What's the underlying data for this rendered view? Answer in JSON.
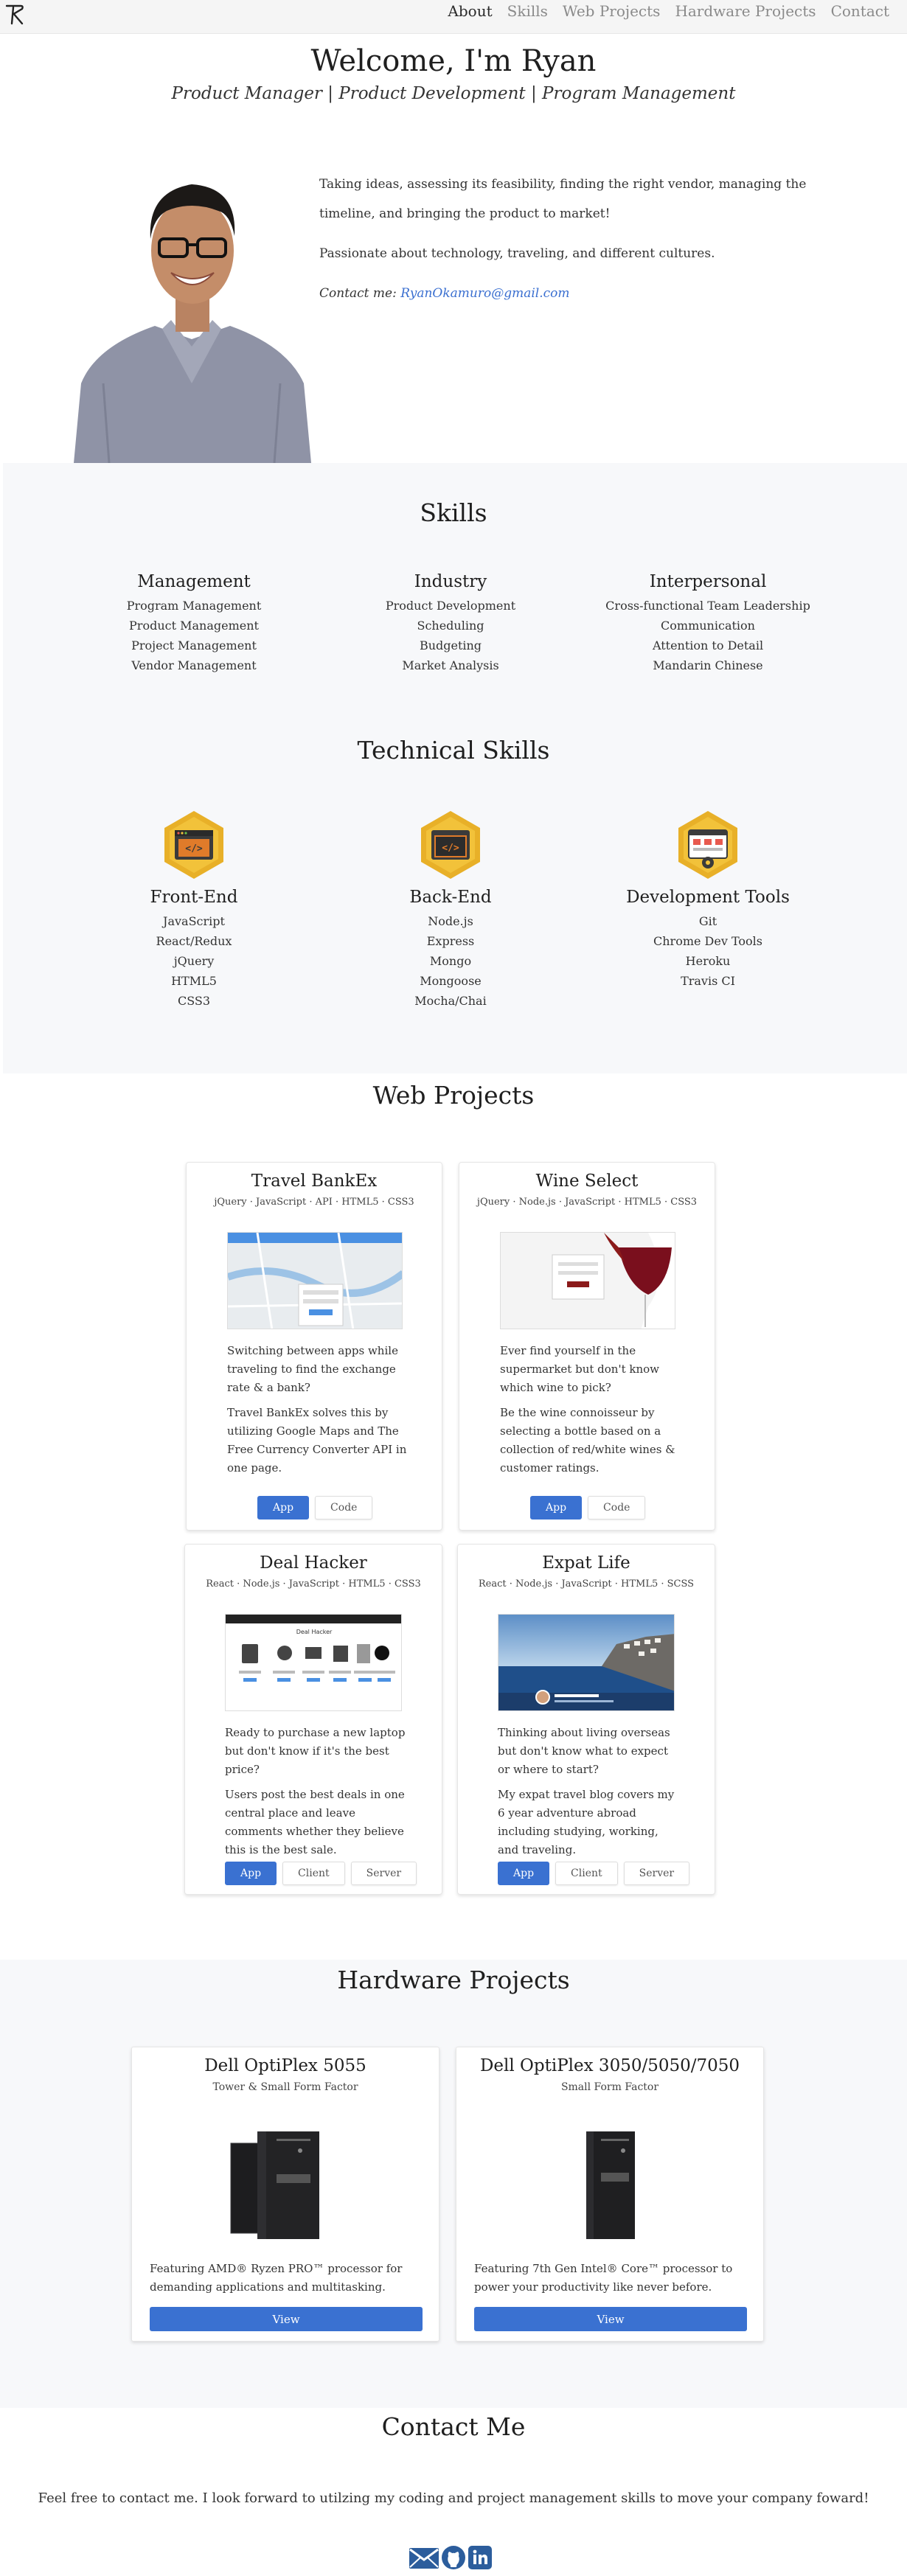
{
  "nav": {
    "links": [
      "About",
      "Skills",
      "Web Projects",
      "Hardware Projects",
      "Contact"
    ],
    "active": "About"
  },
  "hero": {
    "title": "Welcome, I'm Ryan",
    "subtitle": "Product Manager | Product Development | Program Management",
    "about": [
      "Taking ideas, assessing its feasibility, finding the right vendor, managing the timeline, and bringing the product to market!",
      "Passionate about technology, traveling, and different cultures."
    ],
    "contact_label": "Contact me:",
    "contact_email": "RyanOkamuro@gmail.com"
  },
  "skills": {
    "title": "Skills",
    "columns": [
      {
        "heading": "Management",
        "items": [
          "Program Management",
          "Product Management",
          "Project Management",
          "Vendor Management"
        ]
      },
      {
        "heading": "Industry",
        "items": [
          "Product Development",
          "Scheduling",
          "Budgeting",
          "Market Analysis"
        ]
      },
      {
        "heading": "Interpersonal",
        "items": [
          "Cross-functional Team Leadership",
          "Communication",
          "Attention to Detail",
          "Mandarin Chinese"
        ]
      }
    ]
  },
  "technical": {
    "title": "Technical Skills",
    "columns": [
      {
        "heading": "Front-End",
        "icon": "code-browser-icon",
        "items": [
          "JavaScript",
          "React/Redux",
          "jQuery",
          "HTML5",
          "CSS3"
        ]
      },
      {
        "heading": "Back-End",
        "icon": "code-terminal-icon",
        "items": [
          "Node.js",
          "Express",
          "Mongo",
          "Mongoose",
          "Mocha/Chai"
        ]
      },
      {
        "heading": "Development Tools",
        "icon": "toolbox-icon",
        "items": [
          "Git",
          "Chrome Dev Tools",
          "Heroku",
          "Travis CI"
        ]
      }
    ]
  },
  "web_projects": {
    "title": "Web Projects",
    "cards": [
      {
        "title": "Travel BankEx",
        "tags": "jQuery · JavaScript · API · HTML5 · CSS3",
        "desc": [
          "Switching between apps while traveling to find the exchange rate & a bank?",
          "Travel BankEx solves this by utilizing Google Maps and The Free Currency Converter API in one page."
        ],
        "buttons": [
          "App",
          "Code"
        ]
      },
      {
        "title": "Wine Select",
        "tags": "jQuery · Node.js · JavaScript · HTML5 · CSS3",
        "desc": [
          "Ever find yourself in the supermarket but don't know which wine to pick?",
          "Be the wine connoisseur by selecting a bottle based on a collection of red/white wines & customer ratings."
        ],
        "buttons": [
          "App",
          "Code"
        ]
      },
      {
        "title": "Deal Hacker",
        "tags": "React · Node.js · JavaScript · HTML5 · CSS3",
        "desc": [
          "Ready to purchase a new laptop but don't know if it's the best price?",
          "Users post the best deals in one central place and leave comments whether they believe this is the best sale."
        ],
        "buttons": [
          "App",
          "Client",
          "Server"
        ]
      },
      {
        "title": "Expat Life",
        "tags": "React · Node.js · JavaScript · HTML5 · SCSS",
        "desc": [
          "Thinking about living overseas but don't know what to expect or where to start?",
          "My expat travel blog covers my 6 year adventure abroad including studying, working, and traveling."
        ],
        "buttons": [
          "App",
          "Client",
          "Server"
        ]
      }
    ],
    "screens": {
      "deal_hacker_header": "Deal Hacker"
    }
  },
  "hardware": {
    "title": "Hardware Projects",
    "cards": [
      {
        "title": "Dell OptiPlex 5055",
        "sub": "Tower & Small Form Factor",
        "desc": "Featuring AMD® Ryzen PRO™ processor for demanding applications and multitasking.",
        "button": "View"
      },
      {
        "title": "Dell OptiPlex 3050/5050/7050",
        "sub": "Small Form Factor",
        "desc": "Featuring 7th Gen Intel® Core™ processor to power your productivity like never before.",
        "button": "View"
      }
    ]
  },
  "contact": {
    "title": "Contact Me",
    "text": "Feel free to contact me. I look forward to utilzing my coding and project management skills to move your company foward!",
    "icons": [
      "email-icon",
      "github-icon",
      "linkedin-icon"
    ]
  },
  "colors": {
    "accent": "#3a71d1",
    "band": "#f7f8fa",
    "hex_gold": "#e8b028"
  }
}
